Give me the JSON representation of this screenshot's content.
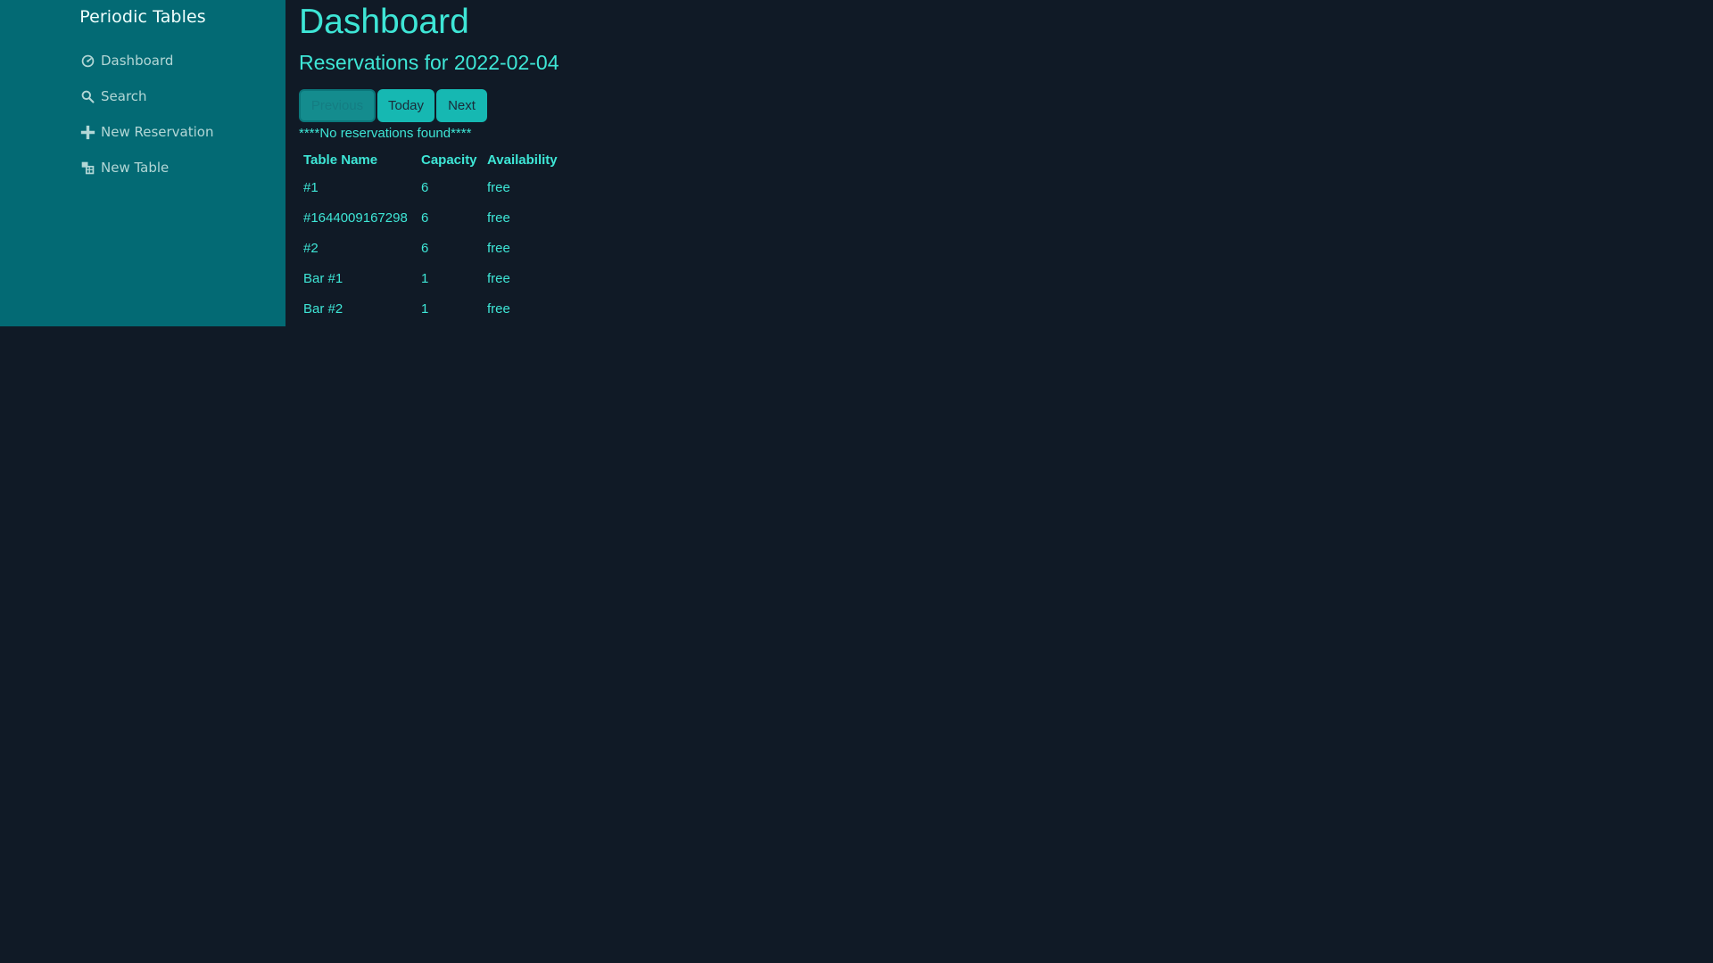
{
  "sidebar": {
    "brand": "Periodic Tables",
    "items": [
      {
        "icon": "dashboard-icon",
        "label": "Dashboard"
      },
      {
        "icon": "search-icon",
        "label": "Search"
      },
      {
        "icon": "plus-icon",
        "label": "New Reservation"
      },
      {
        "icon": "table-icon",
        "label": "New Table"
      }
    ]
  },
  "main": {
    "title": "Dashboard",
    "subtitle": "Reservations for 2022-02-04",
    "buttons": {
      "previous": "Previous",
      "today": "Today",
      "next": "Next"
    },
    "empty_message": "****No reservations found****",
    "table": {
      "headers": [
        "Table Name",
        "Capacity",
        "Availability"
      ],
      "rows": [
        {
          "name": "#1",
          "capacity": "6",
          "availability": "free"
        },
        {
          "name": "#1644009167298",
          "capacity": "6",
          "availability": "free"
        },
        {
          "name": "#2",
          "capacity": "6",
          "availability": "free"
        },
        {
          "name": "Bar #1",
          "capacity": "1",
          "availability": "free"
        },
        {
          "name": "Bar #2",
          "capacity": "1",
          "availability": "free"
        }
      ]
    }
  },
  "colors": {
    "background": "#101a26",
    "sidebar": "#036a74",
    "accent": "#3ee6d6",
    "button": "#16b8b2"
  }
}
